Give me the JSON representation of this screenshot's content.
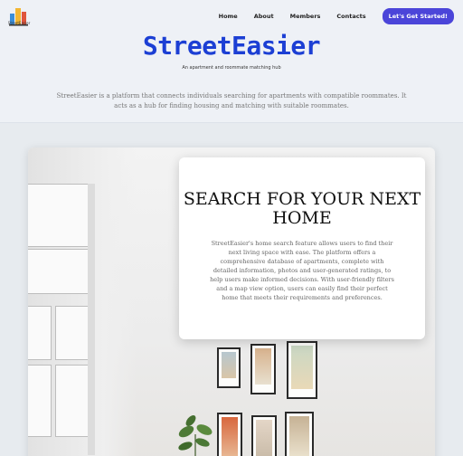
{
  "brand": {
    "logo_text": "StreetEasier"
  },
  "nav": {
    "links": [
      "Home",
      "About",
      "Members",
      "Contacts"
    ],
    "cta_label": "Let's Get Started!"
  },
  "hero": {
    "title": "StreetEasier",
    "tagline": "An apartment and roommate matching hub",
    "description": "StreetEasier is a platform that connects individuals searching for apartments with compatible roommates. It acts as a hub for finding housing and matching with suitable roommates."
  },
  "feature": {
    "title": "SEARCH FOR YOUR NEXT HOME",
    "text": "StreetEasier's home search feature allows users to find their next living space with ease. The platform offers a comprehensive database of apartments, complete with detailed information, photos and user-generated ratings, to help users make informed decisions. With user-friendly filters and a map view option, users can easily find their perfect home that meets their requirements and preferences."
  },
  "colors": {
    "accent": "#1c3fd4",
    "cta": "#4b45d9"
  }
}
